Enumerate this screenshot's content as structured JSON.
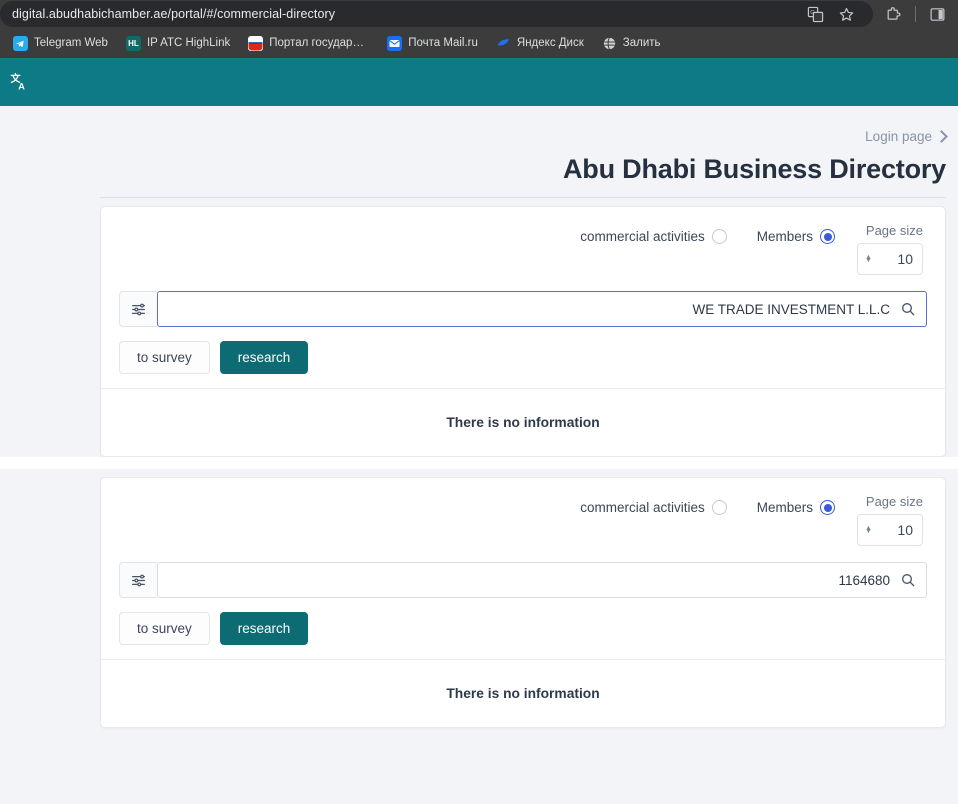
{
  "browser": {
    "url": "digital.abudhabichamber.ae/portal/#/commercial-directory",
    "toolbar_icons": [
      "translate-icon",
      "bookmark-star-icon",
      "extensions-icon",
      "side-panel-icon"
    ],
    "bookmarks": [
      {
        "label": "Telegram Web",
        "icon": "telegram-icon",
        "color": "#2aabee",
        "short": ""
      },
      {
        "label": "IP ATC HighLink",
        "icon": "highlink-icon",
        "color": "#0f6b66",
        "short": "HL"
      },
      {
        "label": "Портал государст…",
        "icon": "gosuslugi-icon",
        "color": "#ffffff",
        "short": ""
      },
      {
        "label": "Почта Mail.ru",
        "icon": "mailru-icon",
        "color": "#1a6ef5",
        "short": ""
      },
      {
        "label": "Яндекс Диск",
        "icon": "yandex-disk-icon",
        "color": "#1a73e8",
        "short": ""
      },
      {
        "label": "Залить",
        "icon": "globe-icon",
        "color": "#9aa0a6",
        "short": ""
      }
    ]
  },
  "site_header": {
    "icon": "translate-icon",
    "color": "#0d7a85"
  },
  "header": {
    "login_link": "Login page",
    "title": "Abu Dhabi Business Directory"
  },
  "colors": {
    "teal": "#0d6b73",
    "header_teal": "#0d7a85",
    "radio_blue": "#3b5bd9",
    "focus_blue": "#5b6fd4",
    "page_bg": "#f2f4f7"
  },
  "panels": [
    {
      "id": "members-panel-1",
      "radios": [
        {
          "label": "commercial activities",
          "selected": false
        },
        {
          "label": "Members",
          "selected": true
        }
      ],
      "page_size": {
        "label": "Page size",
        "value": "10"
      },
      "search": {
        "value": "WE TRADE INVESTMENT L.L.C",
        "placeholder": "",
        "focused": true,
        "filter_icon": "sliders-icon",
        "search_icon": "search-icon"
      },
      "buttons": {
        "secondary": "to survey",
        "primary": "research"
      },
      "empty_message": "There is no information"
    },
    {
      "id": "members-panel-2",
      "radios": [
        {
          "label": "commercial activities",
          "selected": false
        },
        {
          "label": "Members",
          "selected": true
        }
      ],
      "page_size": {
        "label": "Page size",
        "value": "10"
      },
      "search": {
        "value": "1164680",
        "placeholder": "",
        "focused": false,
        "filter_icon": "sliders-icon",
        "search_icon": "search-icon"
      },
      "buttons": {
        "secondary": "to survey",
        "primary": "research"
      },
      "empty_message": "There is no information"
    }
  ]
}
